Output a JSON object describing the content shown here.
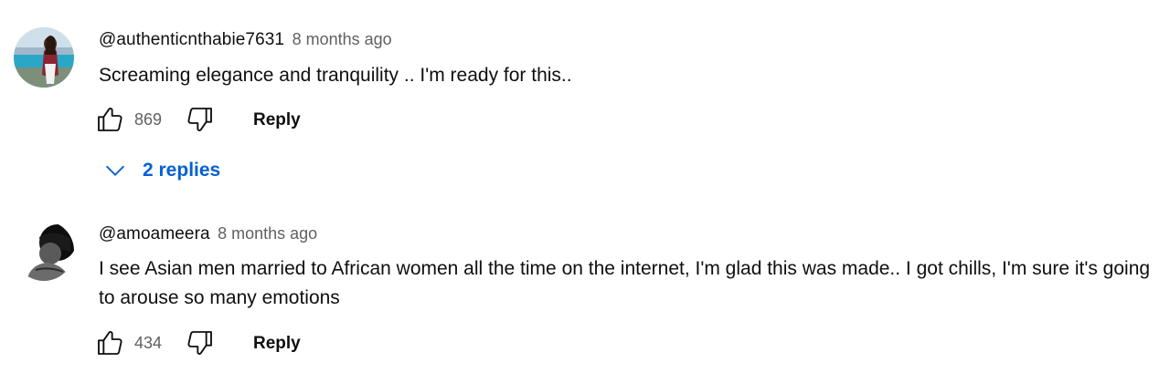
{
  "comments": [
    {
      "author": "@authenticnthabie7631",
      "time": "8 months ago",
      "text": "Screaming elegance and tranquility .. I'm ready for this..",
      "likes": "869",
      "reply_label": "Reply",
      "replies_label": "2 replies"
    },
    {
      "author": "@amoameera",
      "time": "8 months ago",
      "text": "I see Asian men married to African women all the time on the internet, I'm glad this was made.. I got chills, I'm sure it's going to arouse so many emotions",
      "likes": "434",
      "reply_label": "Reply"
    }
  ],
  "colors": {
    "link": "#065fd4",
    "secondary_text": "#606060",
    "primary_text": "#0f0f0f"
  },
  "icons": [
    "like-icon",
    "dislike-icon",
    "chevron-down-icon"
  ]
}
